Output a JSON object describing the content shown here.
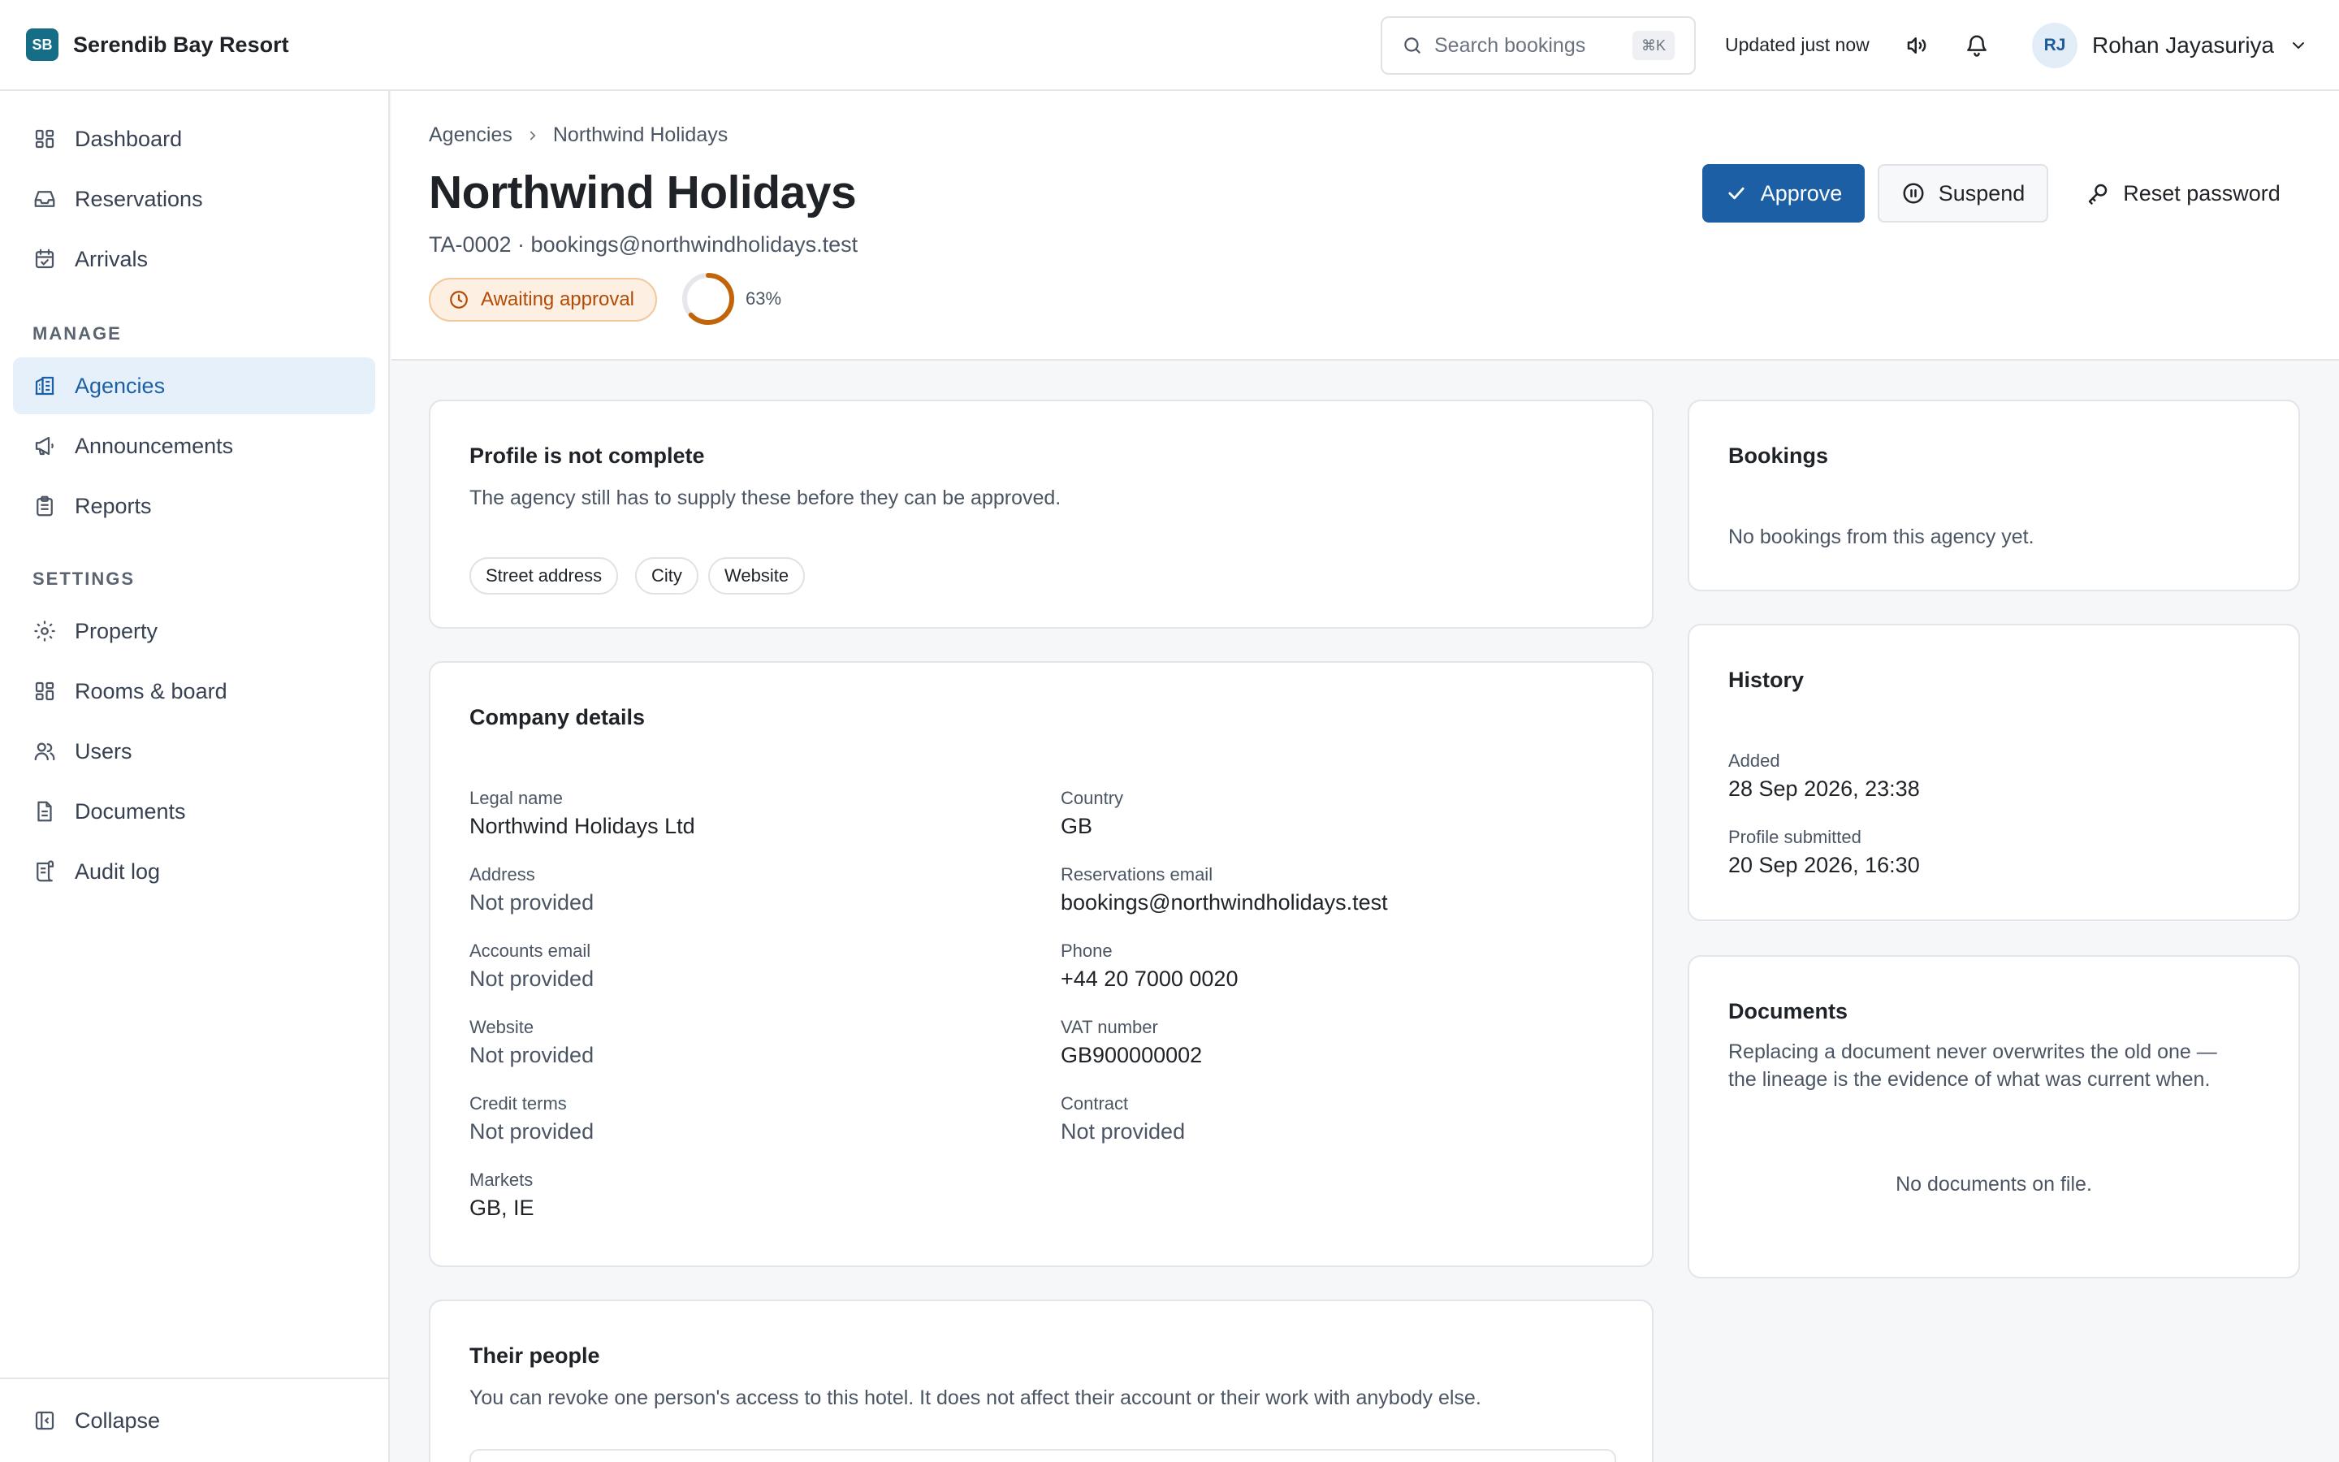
{
  "brand": {
    "logo": "SB",
    "name": "Serendib Bay Resort"
  },
  "header": {
    "search_placeholder": "Search bookings",
    "search_shortcut": "⌘K",
    "updated": "Updated just now",
    "user_initials": "RJ",
    "user_name": "Rohan Jayasuriya"
  },
  "sidebar": {
    "top_items": [
      {
        "label": "Dashboard",
        "icon": "grid-icon"
      },
      {
        "label": "Reservations",
        "icon": "inbox-icon"
      },
      {
        "label": "Arrivals",
        "icon": "calendar-icon"
      }
    ],
    "manage_label": "MANAGE",
    "manage_items": [
      {
        "label": "Agencies",
        "icon": "building-icon",
        "active": true
      },
      {
        "label": "Announcements",
        "icon": "megaphone-icon"
      },
      {
        "label": "Reports",
        "icon": "clipboard-icon"
      }
    ],
    "settings_label": "SETTINGS",
    "settings_items": [
      {
        "label": "Property",
        "icon": "gear-icon"
      },
      {
        "label": "Rooms & board",
        "icon": "grid-icon"
      },
      {
        "label": "Users",
        "icon": "users-icon"
      },
      {
        "label": "Documents",
        "icon": "document-icon"
      },
      {
        "label": "Audit log",
        "icon": "scroll-icon"
      }
    ],
    "collapse_label": "Collapse"
  },
  "page": {
    "breadcrumb": [
      "Agencies",
      "Northwind Holidays"
    ],
    "title": "Northwind Holidays",
    "subtitle": "TA-0002 · bookings@northwindholidays.test",
    "status": "Awaiting approval",
    "progress_percent": 63,
    "progress_label": "63%",
    "actions": {
      "approve": "Approve",
      "suspend": "Suspend",
      "reset": "Reset password"
    }
  },
  "profile_card": {
    "title": "Profile is not complete",
    "text": "The agency still has to supply these before they can be approved.",
    "missing": [
      "Street address",
      "City",
      "Website"
    ]
  },
  "company": {
    "title": "Company details",
    "fields": [
      {
        "label": "Legal name",
        "value": "Northwind Holidays Ltd",
        "muted": false
      },
      {
        "label": "Country",
        "value": "GB",
        "muted": false
      },
      {
        "label": "Address",
        "value": "Not provided",
        "muted": true
      },
      {
        "label": "Reservations email",
        "value": "bookings@northwindholidays.test",
        "muted": false
      },
      {
        "label": "Accounts email",
        "value": "Not provided",
        "muted": true
      },
      {
        "label": "Phone",
        "value": "+44 20 7000 0020",
        "muted": false
      },
      {
        "label": "Website",
        "value": "Not provided",
        "muted": true
      },
      {
        "label": "VAT number",
        "value": "GB900000002",
        "muted": false
      },
      {
        "label": "Credit terms",
        "value": "Not provided",
        "muted": true
      },
      {
        "label": "Contract",
        "value": "Not provided",
        "muted": true
      },
      {
        "label": "Markets",
        "value": "GB, IE",
        "muted": false
      }
    ]
  },
  "people": {
    "title": "Their people",
    "text": "You can revoke one person's access to this hotel. It does not affect their account or their work with anybody else."
  },
  "bookings": {
    "title": "Bookings",
    "empty": "No bookings from this agency yet."
  },
  "history": {
    "title": "History",
    "items": [
      {
        "label": "Added",
        "value": "28 Sep 2026, 23:38"
      },
      {
        "label": "Profile submitted",
        "value": "20 Sep 2026, 16:30"
      }
    ]
  },
  "documents": {
    "title": "Documents",
    "text": "Replacing a document never overwrites the old one — the lineage is the evidence of what was current when.",
    "empty": "No documents on file."
  },
  "colors": {
    "primary": "#1d5fa4",
    "brand": "#166e86",
    "warning": "#b34a06",
    "progress": "#c2650a"
  }
}
